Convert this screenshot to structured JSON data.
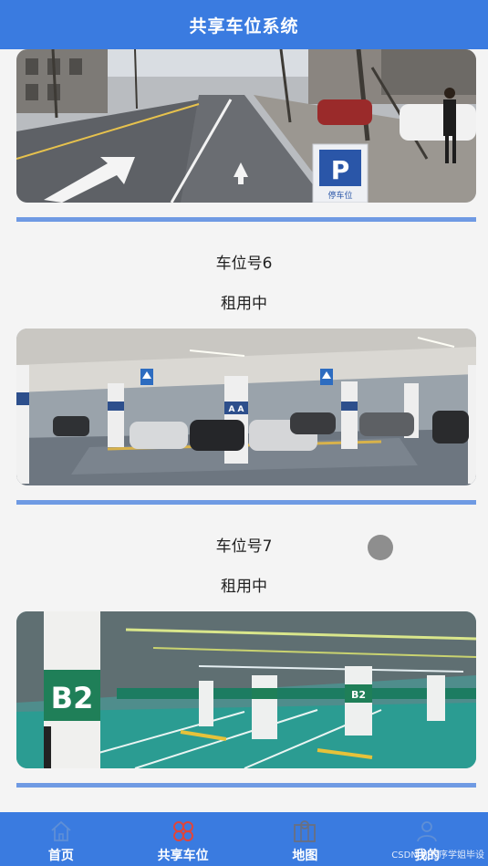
{
  "header": {
    "title": "共享车位系统"
  },
  "spots": [
    {
      "label": "车位号6",
      "status": "租用中"
    },
    {
      "label": "车位号7",
      "status": "租用中"
    }
  ],
  "street_photo": {
    "sign_letter": "P",
    "sign_caption": "停车位"
  },
  "garage_photo": {
    "pillar_sign": "A A"
  },
  "underground_photo": {
    "level_sign": "B2",
    "small_sign": "B2"
  },
  "tabbar": {
    "items": [
      {
        "label": "首页",
        "icon": "home-icon"
      },
      {
        "label": "共享车位",
        "icon": "grid-icon"
      },
      {
        "label": "地图",
        "icon": "map-icon"
      },
      {
        "label": "我的",
        "icon": "user-icon"
      }
    ]
  },
  "watermark": "CSDN @程序学姐毕设",
  "colors": {
    "primary": "#3a7be0",
    "separator": "#6f9ae3",
    "active_icon": "#e0453a"
  }
}
